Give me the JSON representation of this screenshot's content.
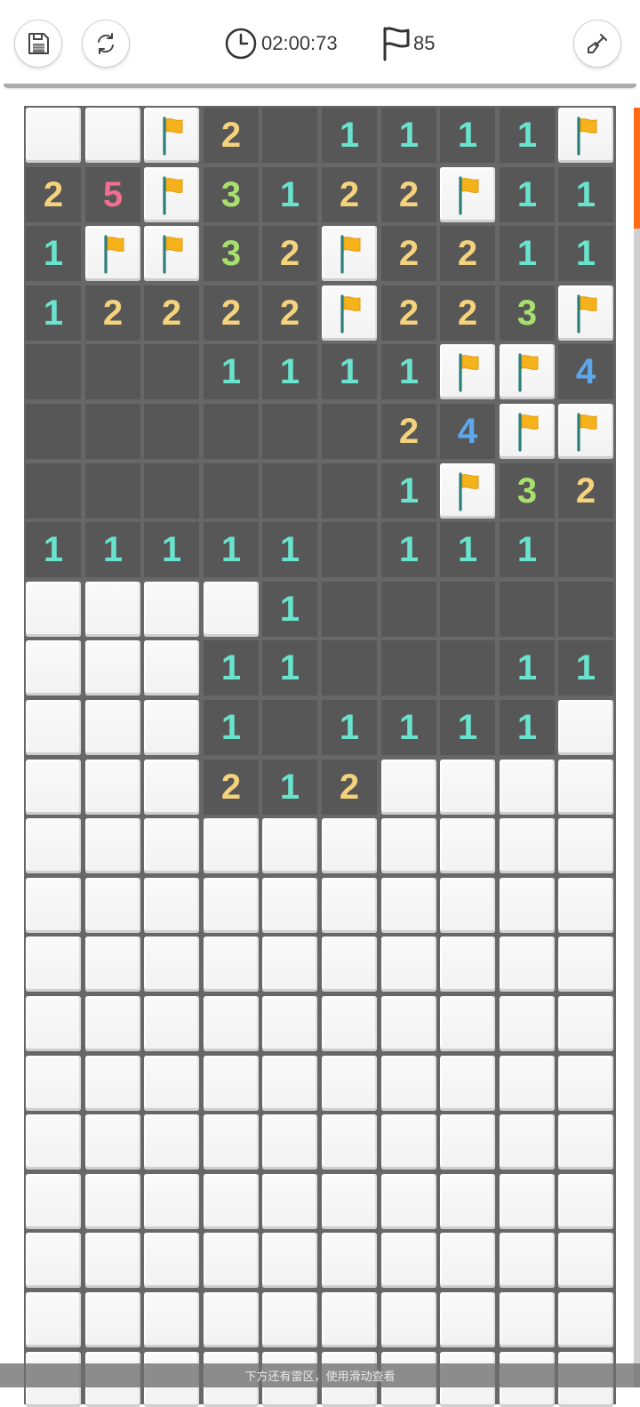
{
  "toolbar": {
    "save_icon": "save-icon",
    "restart_icon": "refresh-icon",
    "tool_icon": "shovel-icon"
  },
  "status": {
    "timer_icon": "clock-icon",
    "timer": "02:00:73",
    "flag_icon": "flag-outline-icon",
    "flags_count": "85"
  },
  "board": {
    "columns": 10,
    "rows": [
      "..F2_1111F",
      "25F3122F11",
      "1FF32F2211",
      "12222F223F",
      "___1111FF4",
      "______24FF",
      "______1F32",
      "11111_111_",
      "....1_____",
      "...11___11",
      "...1_1111.",
      "...212....",
      "..........",
      "..........",
      "..........",
      "..........",
      "..........",
      "..........",
      "..........",
      "..........",
      "..........",
      ".........."
    ],
    "legend": {
      ".": "covered",
      "F": "flagged",
      "_": "revealed-empty",
      "1-8": "revealed-number"
    },
    "number_colors": {
      "1": "#69e3cd",
      "2": "#f5d37d",
      "3": "#a8e06e",
      "4": "#5da7ee",
      "5": "#f06e8f"
    }
  },
  "colors": {
    "board_grid": "#676767",
    "revealed_cell": "#575757",
    "covered_cell": "#f5f5f5",
    "flag": "#f6b21a",
    "scroll_thumb": "#ff6a16"
  },
  "hint": {
    "text": "下方还有雷区，使用滑动查看"
  }
}
